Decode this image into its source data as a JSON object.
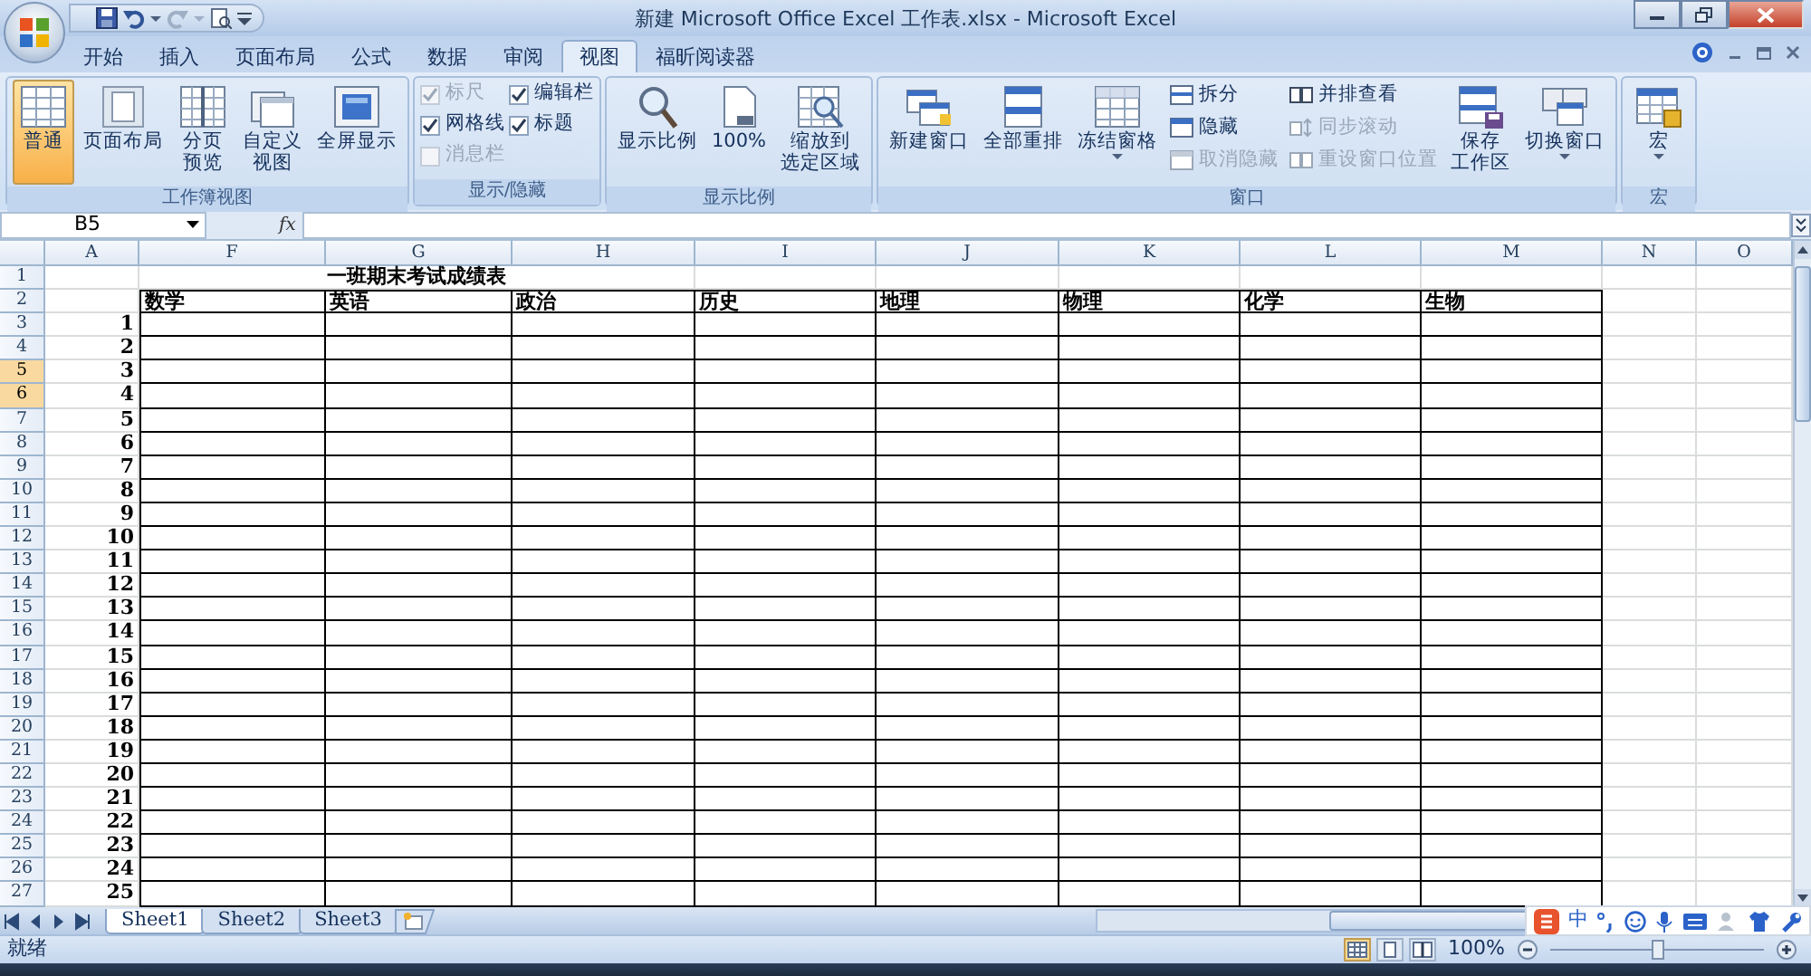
{
  "window": {
    "title": "新建 Microsoft Office Excel 工作表.xlsx - Microsoft Excel"
  },
  "tabs": [
    {
      "label": "开始",
      "selected": false
    },
    {
      "label": "插入",
      "selected": false
    },
    {
      "label": "页面布局",
      "selected": false
    },
    {
      "label": "公式",
      "selected": false
    },
    {
      "label": "数据",
      "selected": false
    },
    {
      "label": "审阅",
      "selected": false
    },
    {
      "label": "视图",
      "selected": true
    },
    {
      "label": "福昕阅读器",
      "selected": false
    }
  ],
  "ribbon": {
    "groups": [
      {
        "label": "工作簿视图",
        "columns": [
          [
            {
              "kind": "large",
              "label": "普通",
              "selected": true
            }
          ],
          [
            {
              "kind": "large",
              "label": "页面布局",
              "selected": false
            }
          ],
          [
            {
              "kind": "large",
              "label_lines": [
                "分页",
                "预览"
              ],
              "selected": false
            }
          ],
          [
            {
              "kind": "large",
              "label_lines": [
                "自定义",
                "视图"
              ],
              "selected": false
            }
          ],
          [
            {
              "kind": "large",
              "label": "全屏显示",
              "selected": false
            }
          ]
        ]
      },
      {
        "label": "显示/隐藏",
        "columns": [
          [
            {
              "kind": "check",
              "label": "标尺",
              "checked": true,
              "disabled": true
            },
            {
              "kind": "check",
              "label": "网格线",
              "checked": true,
              "disabled": false
            },
            {
              "kind": "check",
              "label": "消息栏",
              "checked": false,
              "disabled": true
            }
          ],
          [
            {
              "kind": "check",
              "label": "编辑栏",
              "checked": true,
              "disabled": false
            },
            {
              "kind": "check",
              "label": "标题",
              "checked": true,
              "disabled": false
            }
          ]
        ]
      },
      {
        "label": "显示比例",
        "columns": [
          [
            {
              "kind": "large",
              "label": "显示比例"
            }
          ],
          [
            {
              "kind": "large",
              "label": "100%"
            }
          ],
          [
            {
              "kind": "large",
              "label_lines": [
                "缩放到",
                "选定区域"
              ]
            }
          ]
        ]
      },
      {
        "label": "窗口",
        "columns": [
          [
            {
              "kind": "large",
              "label": "新建窗口"
            }
          ],
          [
            {
              "kind": "large",
              "label": "全部重排"
            }
          ],
          [
            {
              "kind": "large",
              "label": "冻结窗格",
              "dropdown": true
            }
          ],
          [
            {
              "kind": "small",
              "label": "拆分",
              "disabled": false
            },
            {
              "kind": "small",
              "label": "隐藏",
              "disabled": false
            },
            {
              "kind": "small",
              "label": "取消隐藏",
              "disabled": true
            }
          ],
          [
            {
              "kind": "small",
              "label": "并排查看",
              "disabled": false
            },
            {
              "kind": "small",
              "label": "同步滚动",
              "disabled": true
            },
            {
              "kind": "small",
              "label": "重设窗口位置",
              "disabled": true
            }
          ],
          [
            {
              "kind": "large",
              "label_lines": [
                "保存",
                "工作区"
              ]
            }
          ],
          [
            {
              "kind": "large",
              "label": "切换窗口",
              "dropdown": true
            }
          ]
        ]
      },
      {
        "label": "宏",
        "columns": [
          [
            {
              "kind": "large",
              "label": "宏",
              "dropdown": true
            }
          ]
        ]
      }
    ]
  },
  "formula_bar": {
    "name_box": "B5",
    "function_label": "fx"
  },
  "sheet": {
    "columns": [
      "A",
      "F",
      "G",
      "H",
      "I",
      "J",
      "K",
      "L",
      "M",
      "N",
      "O"
    ],
    "rows": [
      {
        "header": "1",
        "selected": false,
        "title": "一班期末考试成绩表"
      },
      {
        "header": "2",
        "selected": false,
        "cells": [
          "数学",
          "英语",
          "政治",
          "历史",
          "地理",
          "物理",
          "化学",
          "生物"
        ]
      },
      {
        "header": "3",
        "selected": false,
        "number": "1"
      },
      {
        "header": "4",
        "selected": false,
        "number": "2"
      },
      {
        "header": "5",
        "selected": true,
        "number": "3"
      },
      {
        "header": "6",
        "selected": true,
        "number": "4"
      },
      {
        "header": "7",
        "selected": false,
        "number": "5"
      },
      {
        "header": "8",
        "selected": false,
        "number": "6"
      },
      {
        "header": "9",
        "selected": false,
        "number": "7"
      },
      {
        "header": "10",
        "selected": false,
        "number": "8"
      },
      {
        "header": "11",
        "selected": false,
        "number": "9"
      },
      {
        "header": "12",
        "selected": false,
        "number": "10"
      },
      {
        "header": "13",
        "selected": false,
        "number": "11"
      },
      {
        "header": "14",
        "selected": false,
        "number": "12"
      },
      {
        "header": "15",
        "selected": false,
        "number": "13"
      },
      {
        "header": "16",
        "selected": false,
        "number": "14"
      },
      {
        "header": "17",
        "selected": false,
        "number": "15"
      },
      {
        "header": "18",
        "selected": false,
        "number": "16"
      },
      {
        "header": "19",
        "selected": false,
        "number": "17"
      },
      {
        "header": "20",
        "selected": false,
        "number": "18"
      },
      {
        "header": "21",
        "selected": false,
        "number": "19"
      },
      {
        "header": "22",
        "selected": false,
        "number": "20"
      },
      {
        "header": "23",
        "selected": false,
        "number": "21"
      },
      {
        "header": "24",
        "selected": false,
        "number": "22"
      },
      {
        "header": "25",
        "selected": false,
        "number": "23"
      },
      {
        "header": "26",
        "selected": false,
        "number": "24"
      },
      {
        "header": "27",
        "selected": false,
        "number": "25"
      }
    ]
  },
  "sheet_tabs": [
    {
      "label": "Sheet1",
      "selected": true
    },
    {
      "label": "Sheet2",
      "selected": false
    },
    {
      "label": "Sheet3",
      "selected": false
    }
  ],
  "ime_toolbar": {
    "mode": "中"
  },
  "status_bar": {
    "text": "就绪",
    "views": [
      {
        "selected": true
      },
      {
        "selected": false
      },
      {
        "selected": false
      }
    ],
    "zoom": "100%",
    "zoom_slider": {
      "level": 0.5
    }
  }
}
